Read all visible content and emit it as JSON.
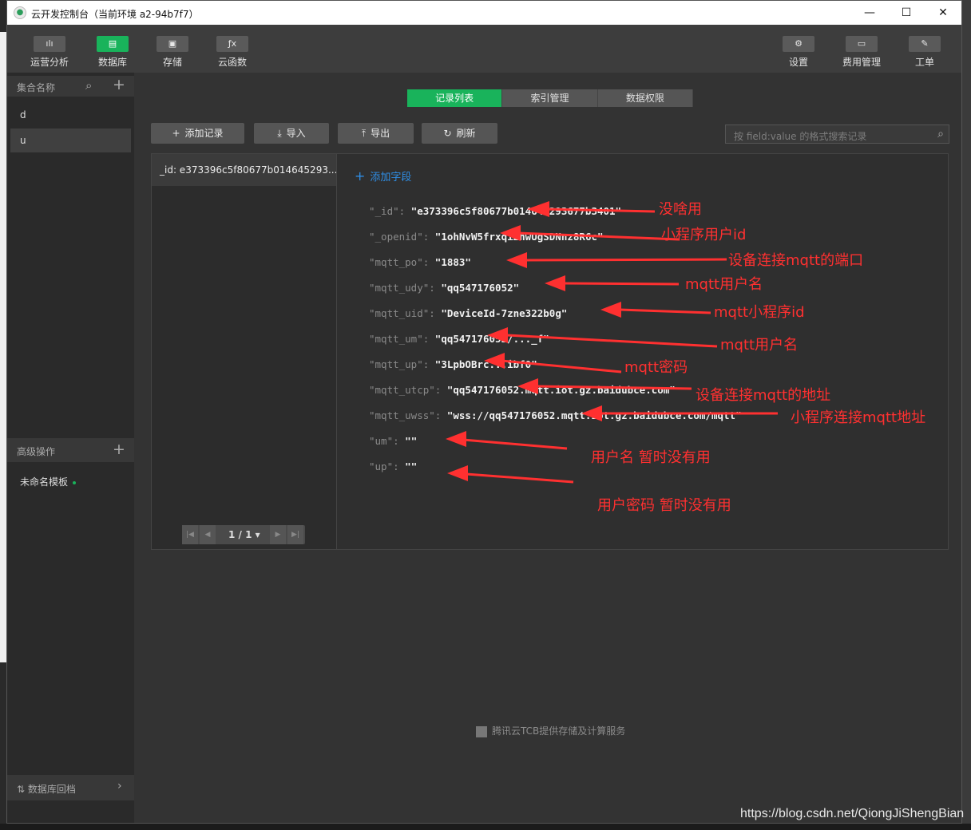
{
  "window": {
    "title": "云开发控制台（当前环境 a2-94b7f7）",
    "controls": {
      "minimize": "—",
      "maximize": "☐",
      "close": "✕"
    }
  },
  "toolbar": {
    "left": [
      {
        "label": "运营分析",
        "icon": "chart-icon",
        "glyph": "ılı",
        "active": false
      },
      {
        "label": "数据库",
        "icon": "database-icon",
        "glyph": "▤",
        "active": true
      },
      {
        "label": "存储",
        "icon": "save-icon",
        "glyph": "▣",
        "active": false
      },
      {
        "label": "云函数",
        "icon": "function-icon",
        "glyph": "ƒx",
        "active": false
      }
    ],
    "right": [
      {
        "label": "设置",
        "icon": "gear-icon",
        "glyph": "⚙"
      },
      {
        "label": "费用管理",
        "icon": "billing-icon",
        "glyph": "▭"
      },
      {
        "label": "工单",
        "icon": "ticket-icon",
        "glyph": "✎"
      }
    ]
  },
  "sidebar": {
    "header": "集合名称",
    "collections": [
      {
        "name": "d",
        "selected": false
      },
      {
        "name": "u",
        "selected": true
      }
    ],
    "advanced_header": "高级操作",
    "template": "未命名模板",
    "footer": "数据库回档"
  },
  "tabs": [
    {
      "label": "记录列表",
      "active": true
    },
    {
      "label": "索引管理",
      "active": false
    },
    {
      "label": "数据权限",
      "active": false
    }
  ],
  "actions": {
    "add_record": "添加记录",
    "import": "导入",
    "export": "导出",
    "refresh": "刷新",
    "search_placeholder": "按 field:value 的格式搜索记录"
  },
  "record_list": {
    "items": [
      "_id: e373396c5f80677b014645293..."
    ],
    "pager": "1 / 1"
  },
  "detail": {
    "add_field": "添加字段",
    "fields": [
      {
        "key": "\"_id\":",
        "value": "\"e373396c5f80677b014645293677b3401\""
      },
      {
        "key": "\"_openid\":",
        "value": "\"1ohNvW5frxqiZhwUgSDNnz8R6c\""
      },
      {
        "key": "\"mqtt_po\":",
        "value": "\"1883\""
      },
      {
        "key": "\"mqtt_udy\":",
        "value": "\"qq547176052\""
      },
      {
        "key": "\"mqtt_uid\":",
        "value": "\"DeviceId-7zne322b0g\""
      },
      {
        "key": "\"mqtt_um\":",
        "value": "\"qq547176052/..._f\""
      },
      {
        "key": "\"mqtt_up\":",
        "value": "\"3LpbOBrc...ibf0\""
      },
      {
        "key": "\"mqtt_utcp\":",
        "value": "\"qq547176052.mqtt.iot.gz.baidubce.com\""
      },
      {
        "key": "\"mqtt_uwss\":",
        "value": "\"wss://qq547176052.mqtt.iot.gz.baidubce.com/mqtt\""
      },
      {
        "key": "\"um\":",
        "value": "\"\""
      },
      {
        "key": "\"up\":",
        "value": "\"\""
      }
    ]
  },
  "annotations": [
    "没啥用",
    "小程序用户id",
    "设备连接mqtt的端口",
    "mqtt用户名",
    "mqtt小程序id",
    "mqtt用户名",
    "mqtt密码",
    "设备连接mqtt的地址",
    "小程序连接mqtt地址",
    "用户名 暂时没有用",
    "用户密码 暂时没有用"
  ],
  "annotation_color": "#ff3030",
  "accent_color": "#19b35b",
  "footer_note": "腾讯云TCB提供存储及计算服务",
  "watermark": "https://blog.csdn.net/QiongJiShengBian"
}
